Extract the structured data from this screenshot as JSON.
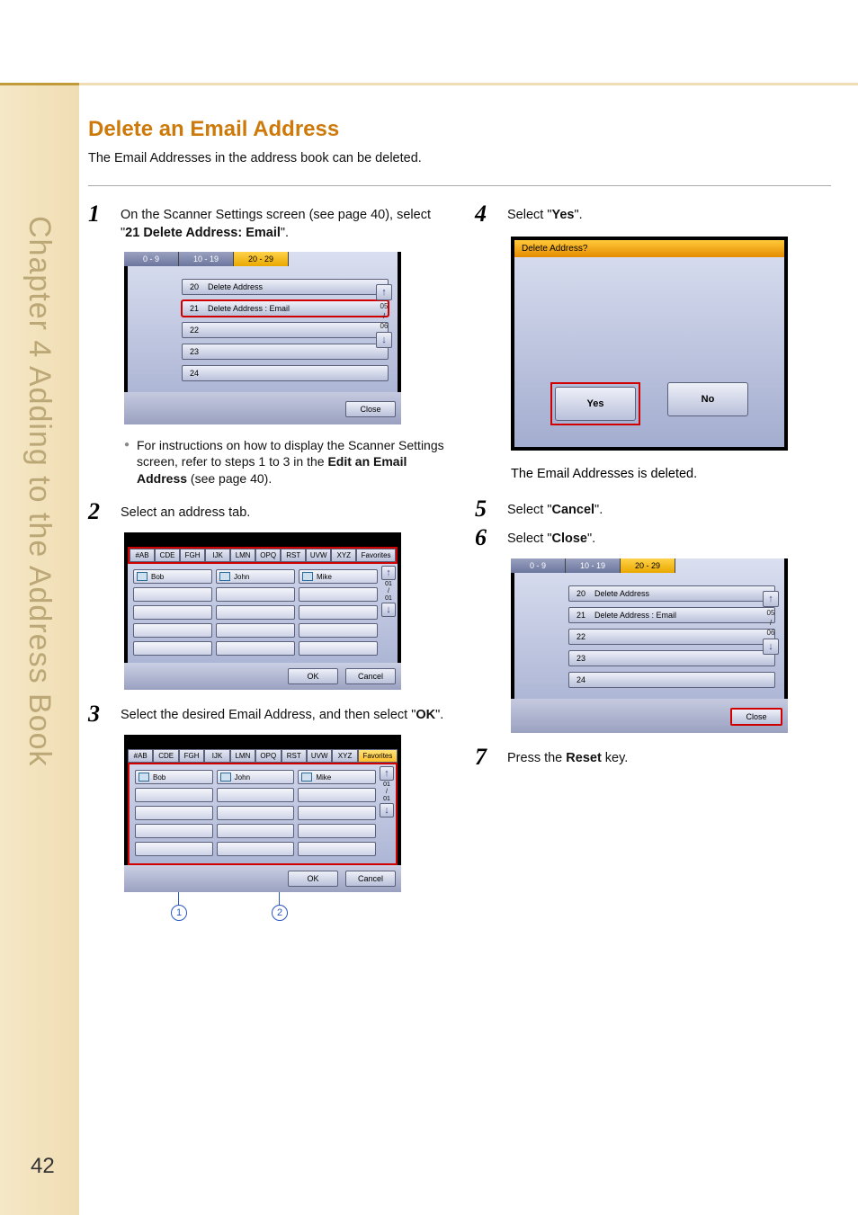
{
  "page_number": "42",
  "side_label": "Chapter 4    Adding to the Address Book",
  "title": "Delete an Email Address",
  "intro": "The Email Addresses in the address book can be deleted.",
  "steps": {
    "s1": {
      "num": "1",
      "pre": "On the Scanner Settings screen (see page 40), select \"",
      "bold": "21 Delete Address: Email",
      "post": "\"."
    },
    "s2": {
      "num": "2",
      "text": "Select an address tab."
    },
    "s3": {
      "num": "3",
      "pre": "Select the desired Email Address, and then select \"",
      "bold": "OK",
      "post": "\"."
    },
    "s4": {
      "num": "4",
      "pre": "Select \"",
      "bold": "Yes",
      "post": "\"."
    },
    "s5": {
      "num": "5",
      "pre": "Select \"",
      "bold": "Cancel",
      "post": "\"."
    },
    "s6": {
      "num": "6",
      "pre": "Select \"",
      "bold": "Close",
      "post": "\"."
    },
    "s7": {
      "num": "7",
      "pre": "Press the ",
      "bold": "Reset",
      "post": " key."
    }
  },
  "note1": {
    "pre": "For instructions on how to display the Scanner Settings screen, refer to steps 1 to 3 in the ",
    "bold": "Edit an Email Address",
    "post": " (see page 40)."
  },
  "result4": "The Email Addresses is deleted.",
  "scanner_settings": {
    "range_tabs": [
      "0  -  9",
      "10 - 19",
      "20 - 29"
    ],
    "active_range_index": 2,
    "rows": [
      {
        "num": "20",
        "label": "Delete Address"
      },
      {
        "num": "21",
        "label": "Delete Address : Email"
      },
      {
        "num": "22",
        "label": ""
      },
      {
        "num": "23",
        "label": ""
      },
      {
        "num": "24",
        "label": ""
      }
    ],
    "page_indicator_top": "05",
    "page_indicator_sep": "/",
    "page_indicator_bot": "06",
    "close": "Close"
  },
  "addr_tabs": [
    "#AB",
    "CDE",
    "FGH",
    "IJK",
    "LMN",
    "OPQ",
    "RST",
    "UVW",
    "XYZ",
    "Favorites"
  ],
  "addr_entries": [
    "Bob",
    "John",
    "Mike"
  ],
  "addr_page": {
    "top": "01",
    "sep": "/",
    "bot": "01"
  },
  "ok": "OK",
  "cancel": "Cancel",
  "confirm": {
    "title": "Delete Address?",
    "yes": "Yes",
    "no": "No"
  },
  "callouts": {
    "c1": "1",
    "c2": "2"
  }
}
